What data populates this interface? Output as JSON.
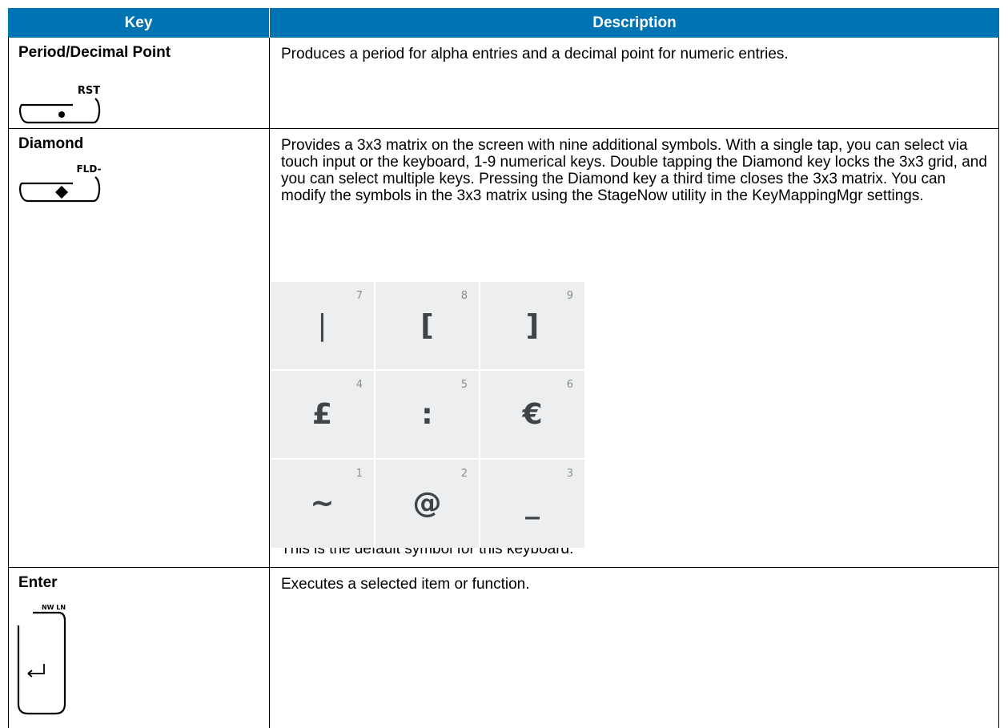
{
  "table": {
    "headers": {
      "key": "Key",
      "description": "Description"
    },
    "rows": [
      {
        "key": "Period/Decimal Point",
        "icon_label": "RST",
        "icon": "period-key-icon",
        "description": "Produces a period for alpha entries and a decimal point for numeric entries."
      },
      {
        "key": "Diamond",
        "icon_label": "FLD-",
        "icon": "diamond-key-icon",
        "description": "Provides a 3x3 matrix on the screen with nine additional symbols. With a single tap, you can select via touch input or the keyboard, 1-9 numerical keys. Double tapping the Diamond key locks the 3x3 grid, and you can select multiple keys. Pressing the Diamond key a third time closes the 3x3 matrix. You can modify the symbols in the 3x3 matrix using the StageNow utility in the KeyMappingMgr settings.",
        "matrix": [
          {
            "num": "7",
            "symbol": "|"
          },
          {
            "num": "8",
            "symbol": "["
          },
          {
            "num": "9",
            "symbol": "]"
          },
          {
            "num": "4",
            "symbol": "£"
          },
          {
            "num": "5",
            "symbol": ":"
          },
          {
            "num": "6",
            "symbol": "€"
          },
          {
            "num": "1",
            "symbol": "~"
          },
          {
            "num": "2",
            "symbol": "@"
          },
          {
            "num": "3",
            "symbol": "_"
          }
        ],
        "note": "This is the default symbol for this keyboard."
      },
      {
        "key": "Enter",
        "icon_label": "NW LN",
        "icon": "enter-key-icon",
        "description": "Executes a selected item or function."
      }
    ]
  },
  "colors": {
    "header_bg": "#0073b3",
    "matrix_cell_bg": "#eceeef"
  }
}
